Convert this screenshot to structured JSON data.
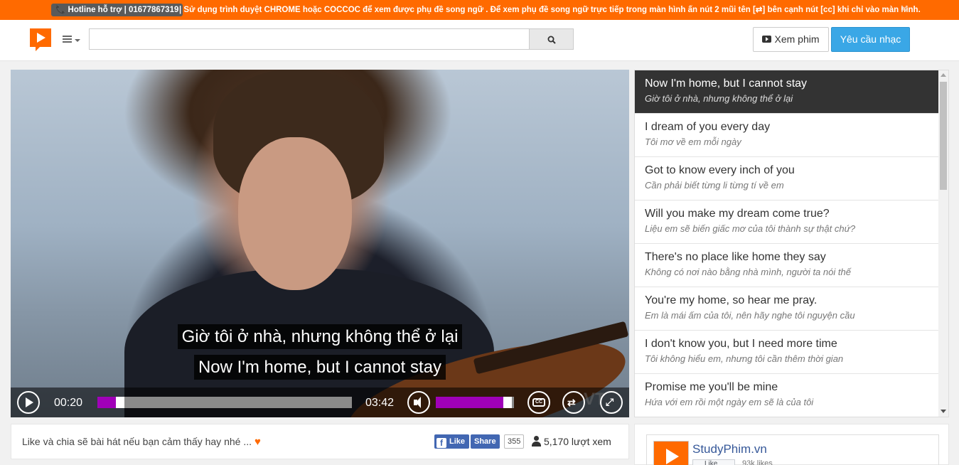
{
  "notice": {
    "hotline": "📞 Hotline hỗ trợ | 01677867319",
    "message": "| Sử dụng trình duyệt CHROME hoặc COCCOC để xem được phụ đề song ngữ . Để xem phụ đề song ngữ trực tiếp trong màn hình ấn nút 2 mũi tên [⇄] bên cạnh nút [cc] khi chỉ vào màn hình.",
    "close": "✕"
  },
  "header": {
    "search_placeholder": "",
    "search_value": "",
    "watch_button": "Xem phim",
    "request_button": "Yêu cầu nhạc"
  },
  "player": {
    "subtitle_vi": "Giờ tôi ở nhà, nhưng không thể ở lại",
    "subtitle_en": "Now I'm home, but I cannot stay",
    "current_time": "00:20",
    "total_time": "03:42",
    "progress_fraction": 0.09,
    "volume_fraction": 0.92,
    "cc_label": "CC",
    "repeat_label": "⇄",
    "fullscreen_label": "⤢",
    "watermark": "VT"
  },
  "lyrics": [
    {
      "en": "Now I'm home, but I cannot stay",
      "vi": "Giờ tôi ở nhà, nhưng không thể ở lại",
      "active": true
    },
    {
      "en": "I dream of you every day",
      "vi": "Tôi mơ về em mỗi ngày",
      "active": false
    },
    {
      "en": "Got to know every inch of you",
      "vi": "Cần phải biết từng li từng tí về em",
      "active": false
    },
    {
      "en": "Will you make my dream come true?",
      "vi": "Liệu em sẽ biến giấc mơ của tôi thành sự thật chứ?",
      "active": false
    },
    {
      "en": "There's no place like home they say",
      "vi": "Không có nơi nào bằng nhà mình, người ta nói thế",
      "active": false
    },
    {
      "en": "You're my home, so hear me pray.",
      "vi": "Em là mái ấm của tôi, nên hãy nghe tôi nguyện cầu",
      "active": false
    },
    {
      "en": "I don't know you, but I need more time",
      "vi": "Tôi không hiểu em, nhưng tôi cần thêm thời gian",
      "active": false
    },
    {
      "en": "Promise me you'll be mine",
      "vi": "Hứa với em rồi một ngày em sẽ là của tôi",
      "active": false
    }
  ],
  "share": {
    "text": "Like và chia sẽ bài hát nếu bạn cảm thấy hay nhé ...",
    "heart": "♥",
    "like_label": "Like",
    "like_icon": "f",
    "share_label": "Share",
    "share_count": "355",
    "views": "5,170 lượt xem"
  },
  "fb_page": {
    "name": "StudyPhim.vn",
    "like_label": "Like",
    "likes": "93k likes"
  }
}
